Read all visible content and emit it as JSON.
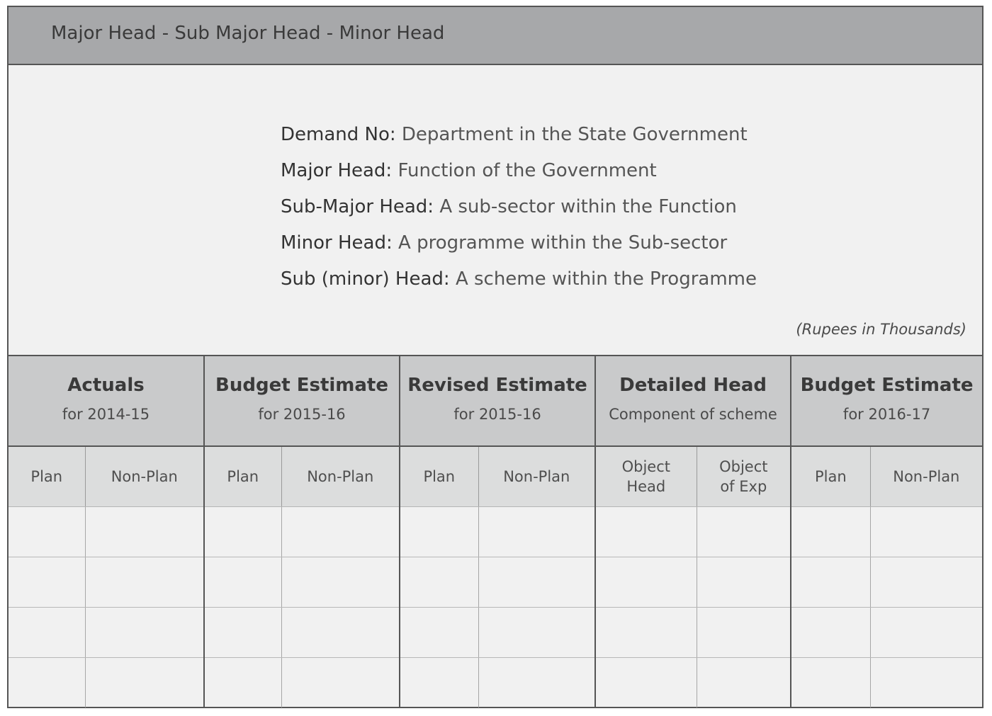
{
  "header": {
    "title": "Major Head - Sub Major Head - Minor Head"
  },
  "definitions": [
    {
      "term": "Demand No:",
      "desc": "Department in the State Government"
    },
    {
      "term": "Major Head:",
      "desc": "Function of the Government"
    },
    {
      "term": "Sub-Major Head:",
      "desc": "A sub-sector within the Function"
    },
    {
      "term": "Minor Head:",
      "desc": "A programme within the Sub-sector"
    },
    {
      "term": "Sub (minor) Head:",
      "desc": "A scheme within the Programme"
    }
  ],
  "units_note": "(Rupees in Thousands)",
  "table": {
    "groups": [
      {
        "title": "Actuals",
        "subtitle": "for 2014-15",
        "cols": [
          "Plan",
          "Non-Plan"
        ]
      },
      {
        "title": "Budget Estimate",
        "subtitle": "for 2015-16",
        "cols": [
          "Plan",
          "Non-Plan"
        ]
      },
      {
        "title": "Revised Estimate",
        "subtitle": "for 2015-16",
        "cols": [
          "Plan",
          "Non-Plan"
        ]
      },
      {
        "title": "Detailed Head",
        "subtitle": "Component of scheme",
        "cols": [
          "Object\nHead",
          "Object\nof Exp"
        ]
      },
      {
        "title": "Budget Estimate",
        "subtitle": "for 2016-17",
        "cols": [
          "Plan",
          "Non-Plan"
        ]
      }
    ],
    "rows": [
      [
        "",
        "",
        "",
        "",
        "",
        "",
        "",
        "",
        "",
        ""
      ],
      [
        "",
        "",
        "",
        "",
        "",
        "",
        "",
        "",
        "",
        ""
      ],
      [
        "",
        "",
        "",
        "",
        "",
        "",
        "",
        "",
        "",
        ""
      ],
      [
        "",
        "",
        "",
        "",
        "",
        "",
        "",
        "",
        "",
        ""
      ]
    ]
  },
  "colors": {
    "header_bar": "#a7a8aa",
    "group_header": "#c9cacb",
    "sub_header": "#dcdddd",
    "body": "#f1f1f1",
    "border": "#555555"
  }
}
